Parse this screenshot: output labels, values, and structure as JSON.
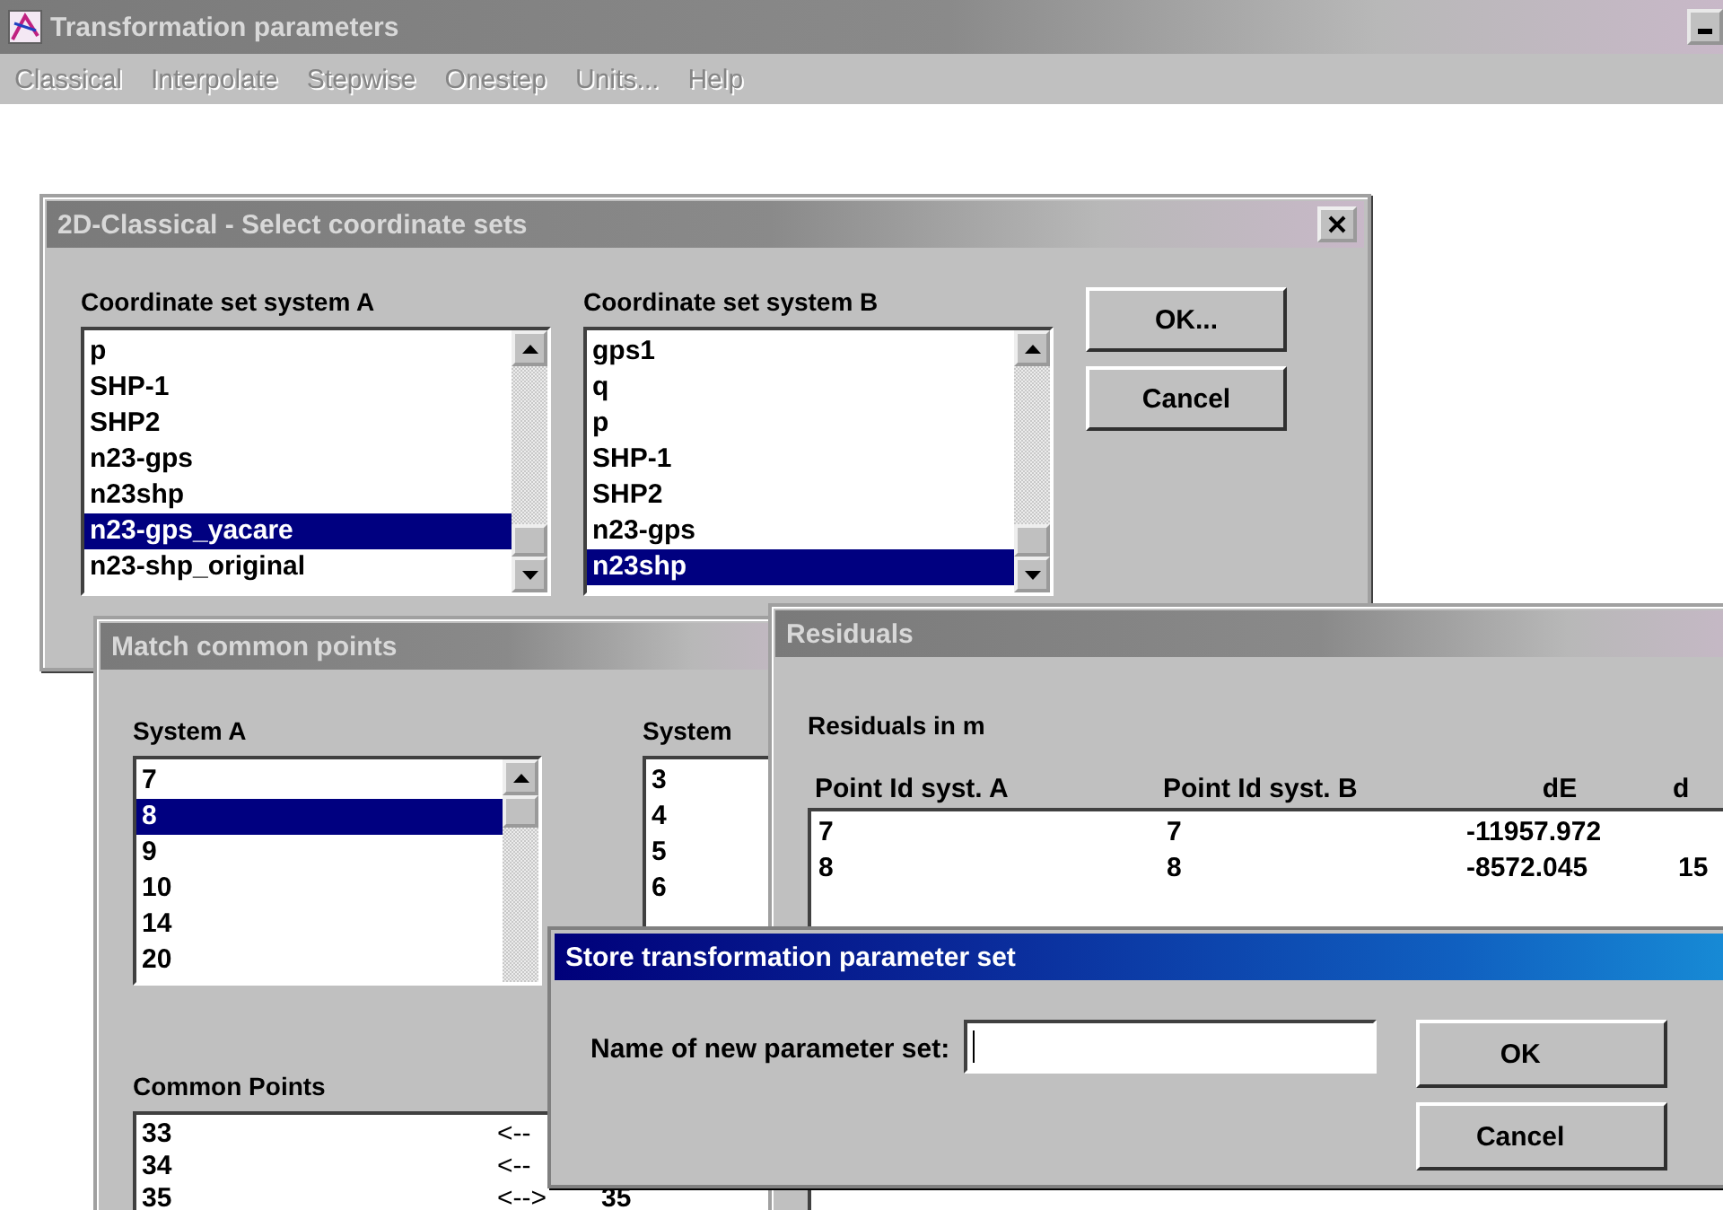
{
  "main_window": {
    "title": "Transformation parameters",
    "menu": [
      {
        "label": "Classical",
        "disabled": true
      },
      {
        "label": "Interpolate",
        "disabled": true
      },
      {
        "label": "Stepwise",
        "disabled": true
      },
      {
        "label": "Onestep",
        "disabled": true
      },
      {
        "label": "Units...",
        "disabled": true
      },
      {
        "label": "Help",
        "disabled": true
      }
    ]
  },
  "classical_dialog": {
    "title": "2D-Classical - Select coordinate sets",
    "active": false,
    "list_a": {
      "label": "Coordinate set system A",
      "items": [
        {
          "text": "p",
          "selected": false
        },
        {
          "text": "SHP-1",
          "selected": false
        },
        {
          "text": "SHP2",
          "selected": false
        },
        {
          "text": "n23-gps",
          "selected": false
        },
        {
          "text": "n23shp",
          "selected": false
        },
        {
          "text": "n23-gps_yacare",
          "selected": true
        },
        {
          "text": "n23-shp_original",
          "selected": false
        }
      ]
    },
    "list_b": {
      "label": "Coordinate set system B",
      "items": [
        {
          "text": "gps1",
          "selected": false
        },
        {
          "text": "q",
          "selected": false
        },
        {
          "text": "p",
          "selected": false
        },
        {
          "text": "SHP-1",
          "selected": false
        },
        {
          "text": "SHP2",
          "selected": false
        },
        {
          "text": "n23-gps",
          "selected": false
        },
        {
          "text": "n23shp",
          "selected": true
        }
      ]
    },
    "buttons": [
      {
        "label": "OK..."
      },
      {
        "label": "Cancel"
      }
    ]
  },
  "match_dialog": {
    "title": "Match common points",
    "active": false,
    "list_a": {
      "label": "System A",
      "items": [
        {
          "text": "7",
          "selected": false
        },
        {
          "text": "8",
          "selected": true
        },
        {
          "text": "9",
          "selected": false
        },
        {
          "text": "10",
          "selected": false
        },
        {
          "text": "14",
          "selected": false
        },
        {
          "text": "20",
          "selected": false
        }
      ]
    },
    "list_b": {
      "label": "System",
      "items": [
        {
          "text": "3",
          "selected": false
        },
        {
          "text": "4",
          "selected": false
        },
        {
          "text": "5",
          "selected": false
        },
        {
          "text": "6",
          "selected": false
        }
      ]
    },
    "common": {
      "label": "Common Points",
      "rows": [
        {
          "a": "33",
          "link": "<--"
        },
        {
          "a": "34",
          "link": "<--"
        },
        {
          "a": "35",
          "link": "<-->",
          "b": "35"
        }
      ]
    }
  },
  "residuals_window": {
    "title": "Residuals",
    "active": false,
    "caption": "Residuals in m",
    "columns": [
      "Point Id syst. A",
      "Point Id syst. B",
      "dE",
      "d"
    ],
    "rows": [
      [
        "7",
        "7",
        "-11957.972",
        ""
      ],
      [
        "8",
        "8",
        "-8572.045",
        "15"
      ]
    ]
  },
  "store_dialog": {
    "title": "Store transformation parameter set",
    "active": true,
    "field_label": "Name of new parameter set:",
    "buttons": [
      {
        "label": "OK"
      },
      {
        "label": "Cancel"
      }
    ]
  }
}
